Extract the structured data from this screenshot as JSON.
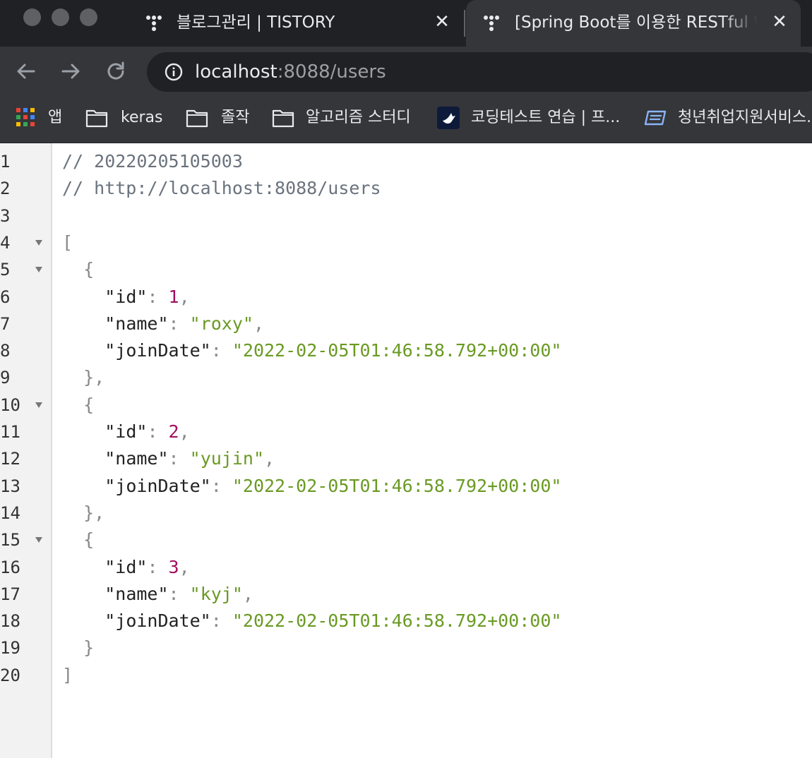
{
  "browser": {
    "tabs": [
      {
        "title": "블로그관리 | TISTORY",
        "active": false
      },
      {
        "title": "[Spring Boot를 이용한 RESTful W",
        "active": true
      }
    ],
    "close_glyph": "✕",
    "url_host": "localhost",
    "url_path": ":8088/users",
    "bookmarks": [
      {
        "label": "앱",
        "icon": "apps-grid-icon"
      },
      {
        "label": "keras",
        "icon": "folder-icon"
      },
      {
        "label": "졸작",
        "icon": "folder-icon"
      },
      {
        "label": "알고리즘 스터디",
        "icon": "folder-icon"
      },
      {
        "label": "코딩테스트 연습 | 프...",
        "icon": "programmers-icon"
      },
      {
        "label": "청년취업지원서비스...",
        "icon": "worknet-icon"
      }
    ]
  },
  "viewer": {
    "lines": [
      {
        "n": "1",
        "comment": "// 20220205105003"
      },
      {
        "n": "2",
        "comment": "// http://localhost:8088/users"
      },
      {
        "n": "3"
      },
      {
        "n": "4",
        "fold": true,
        "text": "["
      },
      {
        "n": "5",
        "fold": true,
        "text": "  {"
      },
      {
        "n": "6",
        "indent": "    ",
        "key": "\"id\"",
        "sep": ": ",
        "num": "1",
        "tail": ","
      },
      {
        "n": "7",
        "indent": "    ",
        "key": "\"name\"",
        "sep": ": ",
        "str": "\"roxy\"",
        "tail": ","
      },
      {
        "n": "8",
        "indent": "    ",
        "key": "\"joinDate\"",
        "sep": ": ",
        "str": "\"2022-02-05T01:46:58.792+00:00\""
      },
      {
        "n": "9",
        "text": "  },"
      },
      {
        "n": "10",
        "fold": true,
        "text": "  {"
      },
      {
        "n": "11",
        "indent": "    ",
        "key": "\"id\"",
        "sep": ": ",
        "num": "2",
        "tail": ","
      },
      {
        "n": "12",
        "indent": "    ",
        "key": "\"name\"",
        "sep": ": ",
        "str": "\"yujin\"",
        "tail": ","
      },
      {
        "n": "13",
        "indent": "    ",
        "key": "\"joinDate\"",
        "sep": ": ",
        "str": "\"2022-02-05T01:46:58.792+00:00\""
      },
      {
        "n": "14",
        "text": "  },"
      },
      {
        "n": "15",
        "fold": true,
        "text": "  {"
      },
      {
        "n": "16",
        "indent": "    ",
        "key": "\"id\"",
        "sep": ": ",
        "num": "3",
        "tail": ","
      },
      {
        "n": "17",
        "indent": "    ",
        "key": "\"name\"",
        "sep": ": ",
        "str": "\"kyj\"",
        "tail": ","
      },
      {
        "n": "18",
        "indent": "    ",
        "key": "\"joinDate\"",
        "sep": ": ",
        "str": "\"2022-02-05T01:46:58.792+00:00\""
      },
      {
        "n": "19",
        "text": "  }"
      },
      {
        "n": "20",
        "text": "]"
      }
    ]
  },
  "colors": {
    "tabstrip_bg": "#202124",
    "toolbar_bg": "#35363a",
    "comment": "#6a737d",
    "number": "#a0105f",
    "string": "#6a9a23"
  }
}
